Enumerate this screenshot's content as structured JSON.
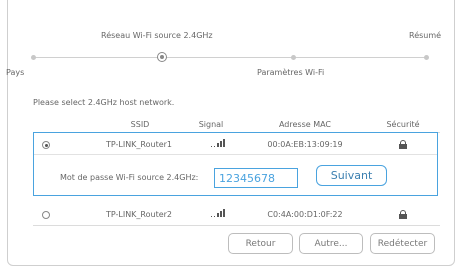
{
  "steps": [
    "Pays",
    "Réseau Wi-Fi source 2.4GHz",
    "Paramètres Wi-Fi",
    "Résumé"
  ],
  "instruction": "Please select 2.4GHz host network.",
  "columns": {
    "ssid": "SSID",
    "signal": "Signal",
    "mac": "Adresse MAC",
    "security": "Sécurité"
  },
  "networks": [
    {
      "ssid": "TP-LINK_Router1",
      "mac": "00:0A:EB:13:09:19",
      "selected": true,
      "signal_icon": "signal-bars-icon",
      "security_icon": "lock-icon"
    },
    {
      "ssid": "TP-LINK_Router2",
      "mac": "C0:4A:00:D1:0F:22",
      "selected": false,
      "signal_icon": "signal-bars-icon",
      "security_icon": "lock-icon"
    }
  ],
  "password": {
    "label": "Mot de passe Wi-Fi source 2.4GHz:",
    "value": "12345678"
  },
  "buttons": {
    "next": "Suivant",
    "back": "Retour",
    "other": "Autre...",
    "rescan": "Redétecter"
  },
  "colors": {
    "accent": "#4aa3df",
    "border": "#cfcfcf",
    "text": "#666666"
  }
}
